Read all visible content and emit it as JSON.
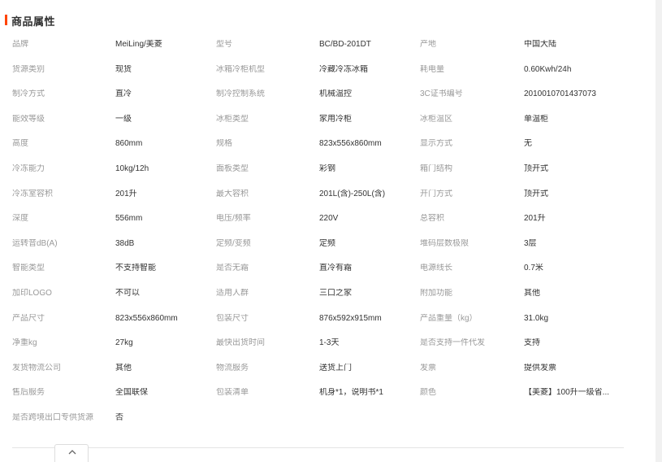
{
  "section": {
    "title": "商品属性",
    "accent_color": "#ff4400"
  },
  "rows": [
    [
      {
        "label": "品牌",
        "value": "MeiLing/美菱"
      },
      {
        "label": "型号",
        "value": "BC/BD-201DT"
      },
      {
        "label": "产地",
        "value": "中国大陆"
      }
    ],
    [
      {
        "label": "货源类别",
        "value": "现货"
      },
      {
        "label": "冰箱冷柜机型",
        "value": "冷藏冷冻冰箱"
      },
      {
        "label": "耗电量",
        "value": "0.60Kwh/24h"
      }
    ],
    [
      {
        "label": "制冷方式",
        "value": "直冷"
      },
      {
        "label": "制冷控制系统",
        "value": "机械温控"
      },
      {
        "label": "3C证书编号",
        "value": "2010010701437073"
      }
    ],
    [
      {
        "label": "能效等级",
        "value": "一级"
      },
      {
        "label": "冰柜类型",
        "value": "家用冷柜"
      },
      {
        "label": "冰柜温区",
        "value": "单温柜"
      }
    ],
    [
      {
        "label": "高度",
        "value": "860mm"
      },
      {
        "label": "规格",
        "value": "823x556x860mm"
      },
      {
        "label": "显示方式",
        "value": "无"
      }
    ],
    [
      {
        "label": "冷冻能力",
        "value": "10kg/12h"
      },
      {
        "label": "面板类型",
        "value": "彩钢"
      },
      {
        "label": "箱门结构",
        "value": "顶开式"
      }
    ],
    [
      {
        "label": "冷冻室容积",
        "value": "201升"
      },
      {
        "label": "最大容积",
        "value": "201L(含)-250L(含)"
      },
      {
        "label": "开门方式",
        "value": "顶开式"
      }
    ],
    [
      {
        "label": "深度",
        "value": "556mm"
      },
      {
        "label": "电压/频率",
        "value": "220V"
      },
      {
        "label": "总容积",
        "value": "201升"
      }
    ],
    [
      {
        "label": "运转音dB(A)",
        "value": "38dB"
      },
      {
        "label": "定频/变频",
        "value": "定频"
      },
      {
        "label": "堆码层数极限",
        "value": "3层"
      }
    ],
    [
      {
        "label": "智能类型",
        "value": "不支持智能"
      },
      {
        "label": "是否无霜",
        "value": "直冷有霜"
      },
      {
        "label": "电源线长",
        "value": "0.7米"
      }
    ],
    [
      {
        "label": "加印LOGO",
        "value": "不可以"
      },
      {
        "label": "适用人群",
        "value": "三口之家"
      },
      {
        "label": "附加功能",
        "value": "其他"
      }
    ],
    [
      {
        "label": "产品尺寸",
        "value": "823x556x860mm"
      },
      {
        "label": "包装尺寸",
        "value": "876x592x915mm"
      },
      {
        "label": "产品重量（kg）",
        "value": "31.0kg"
      }
    ],
    [
      {
        "label": "净重kg",
        "value": "27kg"
      },
      {
        "label": "最快出货时间",
        "value": "1-3天"
      },
      {
        "label": "是否支持一件代发",
        "value": "支持"
      }
    ],
    [
      {
        "label": "发货物流公司",
        "value": "其他"
      },
      {
        "label": "物流服务",
        "value": "送货上门"
      },
      {
        "label": "发票",
        "value": "提供发票"
      }
    ],
    [
      {
        "label": "售后服务",
        "value": "全国联保"
      },
      {
        "label": "包装清单",
        "value": "机身*1，说明书*1"
      },
      {
        "label": "颜色",
        "value": "【美菱】100升一级省..."
      }
    ],
    [
      {
        "label": "是否跨境出口专供货源",
        "value": "否"
      }
    ]
  ],
  "collapse_button": {
    "icon": "chevron-up-icon"
  }
}
